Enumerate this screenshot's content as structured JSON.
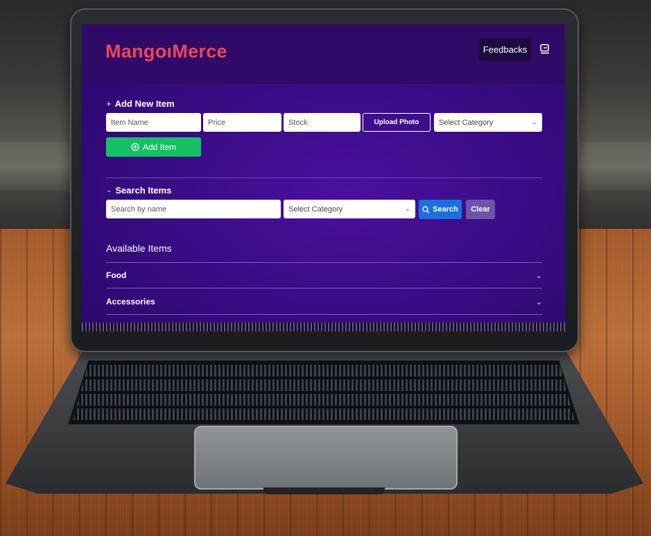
{
  "app": {
    "logo": "MangoıMerce",
    "feedbacks_label": "Feedbacks",
    "logout_icon": "logout-icon",
    "accent": "#f0455a"
  },
  "add_item": {
    "title": "Add New Item",
    "title_icon": "plus-icon",
    "name_placeholder": "Item Name",
    "price_placeholder": "Price",
    "stock_placeholder": "Stock",
    "upload_label": "Upload Photo",
    "category_select": "Select Category",
    "add_button": "Add Item",
    "add_button_icon": "plus-circle-icon",
    "add_button_color": "#16c064"
  },
  "search": {
    "title": "Search Items",
    "title_icon": "chevron-down-icon",
    "name_placeholder": "Search by name",
    "category_select": "Select Category",
    "search_button": "Search",
    "search_icon": "search-icon",
    "search_button_color": "#1a6fe0",
    "clear_button": "Clear"
  },
  "available": {
    "title": "Available Items",
    "categories": [
      {
        "label": "Food"
      },
      {
        "label": "Accessories"
      }
    ]
  }
}
